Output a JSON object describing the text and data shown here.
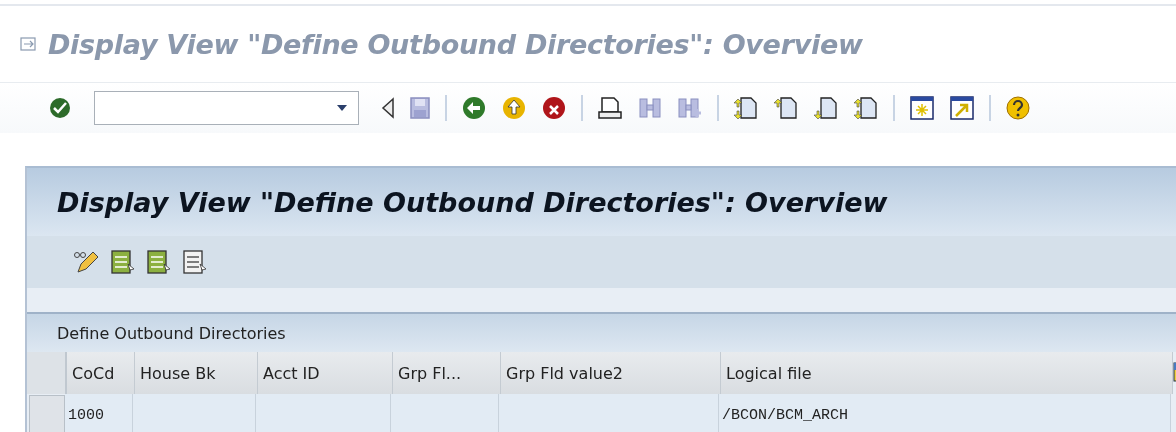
{
  "window": {
    "title": "Display View \"Define Outbound Directories\": Overview"
  },
  "screen": {
    "title": "Display View \"Define Outbound Directories\": Overview"
  },
  "table": {
    "title": "Define Outbound Directories",
    "columns": [
      "CoCd",
      "House Bk",
      "Acct ID",
      "Grp Fl...",
      "Grp Fld value2",
      "Logical file"
    ],
    "rows": [
      [
        "1000",
        "",
        "",
        "",
        "",
        "/BCON/BCM_ARCH"
      ]
    ]
  }
}
